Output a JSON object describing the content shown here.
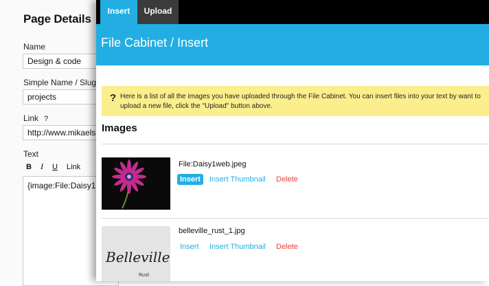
{
  "editor": {
    "title": "Page Details",
    "name_label": "Name",
    "name_value": "Design & code",
    "simple_name_label": "Simple Name / Slug",
    "simple_name_value": "projects",
    "link_label": "Link",
    "link_help": "?",
    "link_value": "http://www.mikaels",
    "text_label": "Text",
    "toolbar": {
      "bold": "B",
      "italic": "I",
      "underline": "U",
      "link": "Link"
    },
    "text_value": "{image:File:Daisy1"
  },
  "panel": {
    "tabs": [
      {
        "label": "Insert",
        "active": true
      },
      {
        "label": "Upload",
        "active": false
      }
    ],
    "heading": "File Cabinet / Insert",
    "notice_icon": "?",
    "notice_text": "Here is a list of all the images you have uploaded through the File Cabinet. You can insert files into your text by want to upload a new file, click the \"Upload\" button above.",
    "section_title": "Images",
    "images": [
      {
        "name": "File:Daisy1web.jpeg",
        "insert": "Insert",
        "insert_thumbnail": "Insert Thumbnail",
        "delete": "Delete"
      },
      {
        "name": "belleville_rust_1.jpg",
        "insert": "Insert",
        "insert_thumbnail": "Insert Thumbnail",
        "delete": "Delete",
        "thumb_text": "Belleville",
        "thumb_subtext": "Rust"
      }
    ]
  },
  "colors": {
    "accent": "#22aee3",
    "notice": "#fbef8d",
    "delete": "#e8413a",
    "tabbar": "#000000",
    "tab_inactive": "#3b3b3b"
  }
}
